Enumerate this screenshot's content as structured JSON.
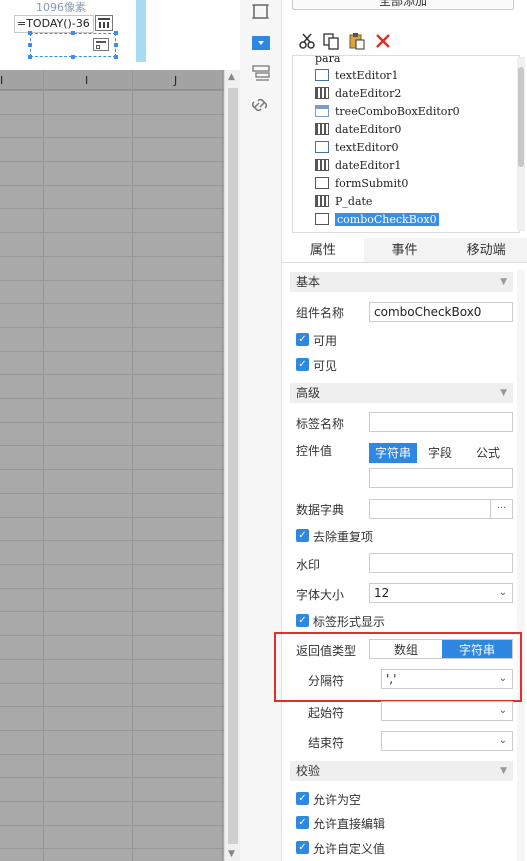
{
  "canvas": {
    "pixel_label": "1096像素",
    "formula_text": "=TODAY()-36",
    "columns": [
      "I",
      "I",
      "J"
    ]
  },
  "toolbar_icons": [
    "frame-icon",
    "dropdown-widget-icon",
    "layers-icon",
    "link-icon"
  ],
  "right_panel": {
    "add_all_label": "全部添加",
    "edit_toolbar": [
      "cut-icon",
      "copy-icon",
      "paste-icon",
      "delete-icon"
    ],
    "tree": {
      "root": "para",
      "items": [
        {
          "label": "textEditor1",
          "icon": "text-field-icon"
        },
        {
          "label": "dateEditor2",
          "icon": "calendar-icon"
        },
        {
          "label": "treeComboBoxEditor0",
          "icon": "tree-combo-icon"
        },
        {
          "label": "dateEditor0",
          "icon": "calendar-icon"
        },
        {
          "label": "textEditor0",
          "icon": "text-field-icon"
        },
        {
          "label": "dateEditor1",
          "icon": "calendar-icon"
        },
        {
          "label": "formSubmit0",
          "icon": "search-form-icon"
        },
        {
          "label": "P_date",
          "icon": "calendar-icon"
        },
        {
          "label": "comboCheckBox0",
          "icon": "combo-checkbox-icon",
          "selected": true
        }
      ]
    },
    "tabs": [
      {
        "label": "属性",
        "active": true
      },
      {
        "label": "事件",
        "active": false
      },
      {
        "label": "移动端",
        "active": false
      }
    ],
    "basic": {
      "title": "基本",
      "name_label": "组件名称",
      "name_value": "comboCheckBox0",
      "enabled_label": "可用",
      "visible_label": "可见"
    },
    "advanced": {
      "title": "高级",
      "tag_name_label": "标签名称",
      "widget_value_label": "控件值",
      "widget_value_options": [
        "字符串",
        "字段",
        "公式"
      ],
      "dict_label": "数据字典",
      "dict_btn": "···",
      "dedupe_label": "去除重复项",
      "watermark_label": "水印",
      "font_size_label": "字体大小",
      "font_size_value": "12",
      "tag_display_label": "标签形式显示",
      "return_type_label": "返回值类型",
      "return_type_options": [
        "数组",
        "字符串"
      ],
      "separator_label": "分隔符",
      "separator_value": "','",
      "start_label": "起始符",
      "end_label": "结束符"
    },
    "validation": {
      "title": "校验",
      "allow_empty": "允许为空",
      "allow_direct_edit": "允许直接编辑",
      "allow_custom": "允许自定义值"
    }
  },
  "colors": {
    "accent": "#2e87e0",
    "selection": "#3b8ee8",
    "highlight_box": "#e0302b",
    "delete_red": "#e0302b"
  }
}
